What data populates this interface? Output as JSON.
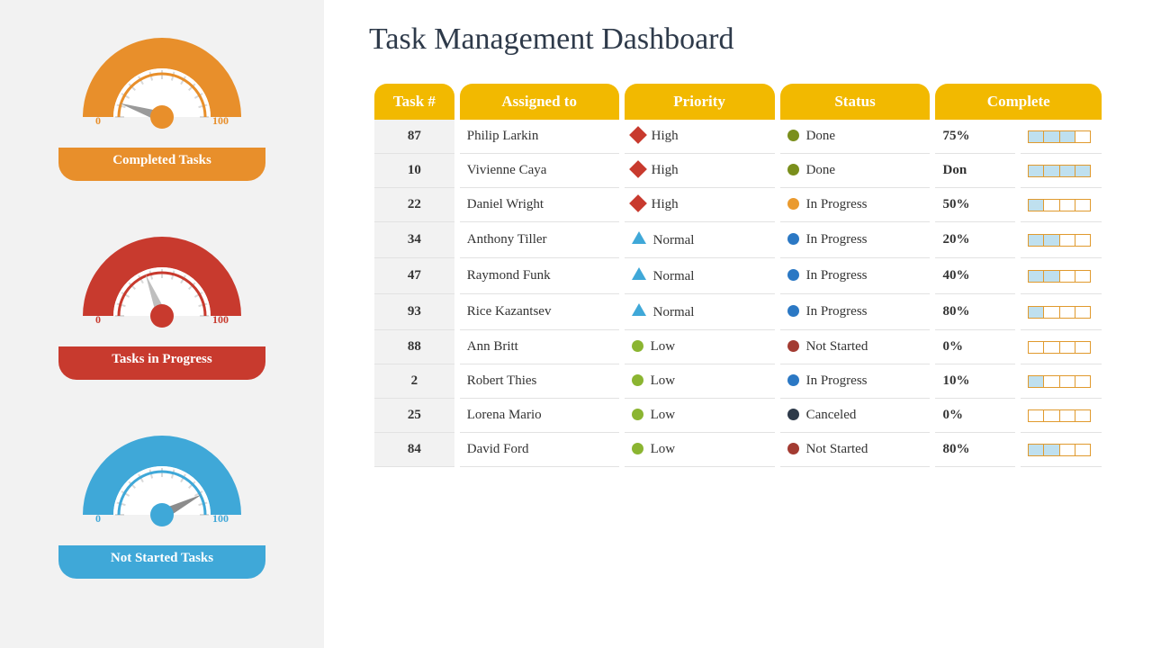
{
  "title": "Task Management Dashboard",
  "gauges": [
    {
      "label": "Completed Tasks",
      "min": "0",
      "max": "100",
      "value": 10,
      "color": "#e88f2b",
      "needle": "#9a9a9a"
    },
    {
      "label": "Tasks in Progress",
      "min": "0",
      "max": "100",
      "value": 38,
      "color": "#c83a2e",
      "needle": "#bfbfbf"
    },
    {
      "label": "Not Started Tasks",
      "min": "0",
      "max": "100",
      "value": 85,
      "color": "#3fa8d8",
      "needle": "#8c8c8c"
    }
  ],
  "columns": {
    "task": "Task #",
    "assigned": "Assigned to",
    "priority": "Priority",
    "status": "Status",
    "complete": "Complete"
  },
  "priority_defs": {
    "high": {
      "label": "High",
      "shape": "diamond"
    },
    "normal": {
      "label": "Normal",
      "shape": "tri"
    },
    "low": {
      "label": "Low",
      "shape": "dot",
      "dotClass": "green"
    }
  },
  "status_defs": {
    "done": {
      "label": "Done",
      "dotClass": "olive"
    },
    "inprogress": {
      "label": "In Progress",
      "dotClass": "blue"
    },
    "inprogressO": {
      "label": "In Progress",
      "dotClass": "orange"
    },
    "notstarted": {
      "label": "Not Started",
      "dotClass": "red"
    },
    "canceled": {
      "label": "Canceled",
      "dotClass": "dark"
    }
  },
  "rows": [
    {
      "num": "87",
      "name": "Philip Larkin",
      "priority": "high",
      "status": "done",
      "complete": "75%",
      "segments": 3
    },
    {
      "num": "10",
      "name": "Vivienne Caya",
      "priority": "high",
      "status": "done",
      "complete": "Don",
      "segments": 4
    },
    {
      "num": "22",
      "name": "Daniel Wright",
      "priority": "high",
      "status": "inprogressO",
      "complete": "50%",
      "segments": 1
    },
    {
      "num": "34",
      "name": "Anthony Tiller",
      "priority": "normal",
      "status": "inprogress",
      "complete": "20%",
      "segments": 2
    },
    {
      "num": "47",
      "name": "Raymond Funk",
      "priority": "normal",
      "status": "inprogress",
      "complete": "40%",
      "segments": 2
    },
    {
      "num": "93",
      "name": "Rice Kazantsev",
      "priority": "normal",
      "status": "inprogress",
      "complete": "80%",
      "segments": 1
    },
    {
      "num": "88",
      "name": "Ann Britt",
      "priority": "low",
      "status": "notstarted",
      "complete": "0%",
      "segments": 0
    },
    {
      "num": "2",
      "name": "Robert Thies",
      "priority": "low",
      "status": "inprogress",
      "complete": "10%",
      "segments": 1
    },
    {
      "num": "25",
      "name": "Lorena Mario",
      "priority": "low",
      "status": "canceled",
      "complete": "0%",
      "segments": 0
    },
    {
      "num": "84",
      "name": "David Ford",
      "priority": "low",
      "status": "notstarted",
      "complete": "80%",
      "segments": 2
    }
  ],
  "chart_data": [
    {
      "type": "gauge",
      "title": "Completed Tasks",
      "min": 0,
      "max": 100,
      "value": 10
    },
    {
      "type": "gauge",
      "title": "Tasks in Progress",
      "min": 0,
      "max": 100,
      "value": 38
    },
    {
      "type": "gauge",
      "title": "Not Started Tasks",
      "min": 0,
      "max": 100,
      "value": 85
    },
    {
      "type": "table",
      "columns": [
        "Task #",
        "Assigned to",
        "Priority",
        "Status",
        "Complete"
      ],
      "rows": [
        [
          87,
          "Philip Larkin",
          "High",
          "Done",
          "75%"
        ],
        [
          10,
          "Vivienne Caya",
          "High",
          "Done",
          "Don"
        ],
        [
          22,
          "Daniel Wright",
          "High",
          "In Progress",
          "50%"
        ],
        [
          34,
          "Anthony Tiller",
          "Normal",
          "In Progress",
          "20%"
        ],
        [
          47,
          "Raymond Funk",
          "Normal",
          "In Progress",
          "40%"
        ],
        [
          93,
          "Rice Kazantsev",
          "Normal",
          "In Progress",
          "80%"
        ],
        [
          88,
          "Ann Britt",
          "Low",
          "Not Started",
          "0%"
        ],
        [
          2,
          "Robert Thies",
          "Low",
          "In Progress",
          "10%"
        ],
        [
          25,
          "Lorena Mario",
          "Low",
          "Canceled",
          "0%"
        ],
        [
          84,
          "David Ford",
          "Low",
          "Not Started",
          "80%"
        ]
      ]
    }
  ]
}
